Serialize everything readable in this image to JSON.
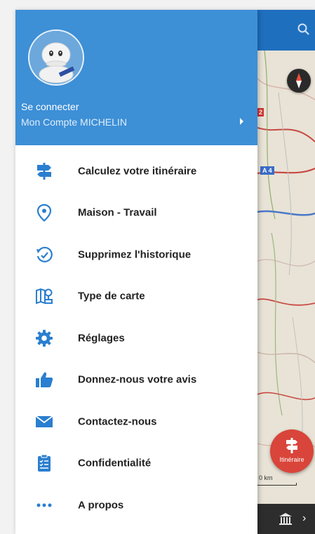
{
  "header": {
    "login_label": "Se connecter",
    "account_label": "Mon Compte MICHELIN"
  },
  "menu": {
    "items": [
      {
        "label": "Calculez votre itinéraire",
        "icon": "signpost-icon"
      },
      {
        "label": "Maison - Travail",
        "icon": "location-pin-icon"
      },
      {
        "label": "Supprimez l'historique",
        "icon": "history-icon"
      },
      {
        "label": "Type de carte",
        "icon": "map-type-icon"
      },
      {
        "label": "Réglages",
        "icon": "gear-icon"
      },
      {
        "label": "Donnez-nous votre avis",
        "icon": "thumbs-up-icon"
      },
      {
        "label": "Contactez-nous",
        "icon": "envelope-icon"
      },
      {
        "label": "Confidentialité",
        "icon": "clipboard-icon"
      },
      {
        "label": "A propos",
        "icon": "more-dots-icon"
      }
    ]
  },
  "map": {
    "road_label_a4": "A 4",
    "road_label_red": "2",
    "itinerary_button_label": "Itinéraire",
    "scale_label": "0 km"
  },
  "colors": {
    "header_blue": "#3d8fd6",
    "icon_blue": "#2a7fd0",
    "topbar_blue": "#1f6fbf",
    "fab_red": "#d9453a"
  }
}
